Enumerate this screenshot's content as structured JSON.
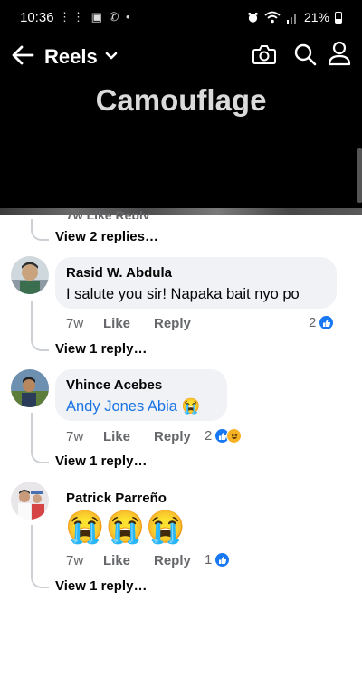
{
  "status_bar": {
    "time": "10:36",
    "left_icons": "⋮⋮ ▣ ✆ •",
    "battery_percent": "21%"
  },
  "header": {
    "title": "Reels",
    "icons": [
      "back-arrow-icon",
      "chevron-down-icon",
      "camera-icon",
      "search-icon",
      "profile-icon"
    ]
  },
  "video": {
    "title": "Camouflage"
  },
  "sheet": {
    "peek_text": "7w   Like   Reply",
    "top_view_replies": "View 2 replies…",
    "comments": [
      {
        "author": "Rasid W. Abdula",
        "text": "I salute you sir! Napaka bait nyo po",
        "time": "7w",
        "like_label": "Like",
        "reply_label": "Reply",
        "reaction_count": "2",
        "reactions": [
          "like"
        ],
        "view_replies": "View 1 reply…"
      },
      {
        "author": "Vhince Acebes",
        "mention": "Andy Jones Abia",
        "emoji": "😭",
        "time": "7w",
        "like_label": "Like",
        "reply_label": "Reply",
        "reaction_count": "2",
        "reactions": [
          "like",
          "haha"
        ],
        "view_replies": "View 1 reply…"
      },
      {
        "author": "Patrick Parreño",
        "emoji_text": "😭😭😭",
        "time": "7w",
        "like_label": "Like",
        "reply_label": "Reply",
        "reaction_count": "1",
        "reactions": [
          "like"
        ],
        "view_replies": "View 1 reply…"
      }
    ]
  },
  "colors": {
    "accent_blue": "#1877f2",
    "mention_blue": "#1b74e4",
    "bubble_gray": "#f0f2f5",
    "meta_gray": "#65676b"
  }
}
